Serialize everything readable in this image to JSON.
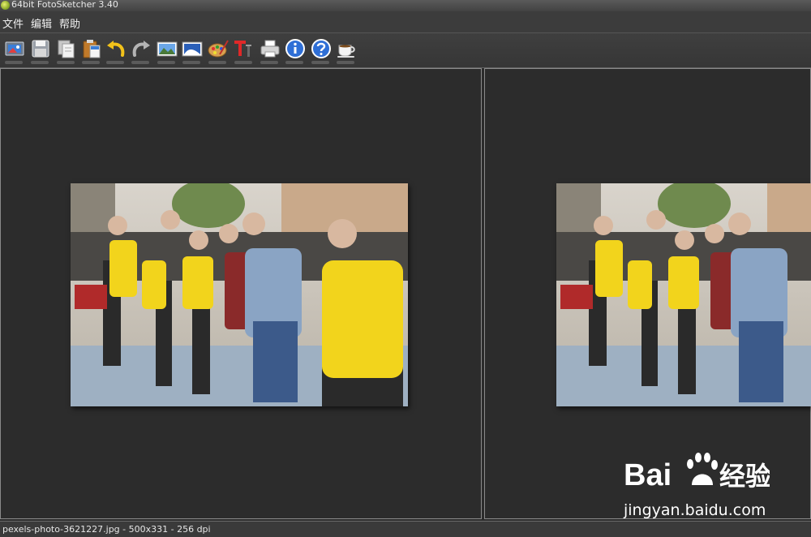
{
  "window": {
    "title": "64bit FotoSketcher 3.40"
  },
  "menu": {
    "items": [
      "文件",
      "编辑",
      "帮助"
    ]
  },
  "toolbar": {
    "buttons": [
      {
        "icon": "open-image-icon"
      },
      {
        "icon": "save-icon"
      },
      {
        "icon": "copy-icon"
      },
      {
        "icon": "paste-icon"
      },
      {
        "icon": "undo-icon"
      },
      {
        "icon": "redo-icon"
      },
      {
        "icon": "original-image-icon"
      },
      {
        "icon": "sketch-image-icon"
      },
      {
        "icon": "palette-icon"
      },
      {
        "icon": "text-icon"
      },
      {
        "icon": "print-icon"
      },
      {
        "icon": "info-icon"
      },
      {
        "icon": "help-icon"
      },
      {
        "icon": "coffee-icon"
      }
    ]
  },
  "status": {
    "text": "pexels-photo-3621227.jpg - 500x331 - 256 dpi"
  },
  "watermark": {
    "logo_text_left": "Bai",
    "logo_text_right": "经验",
    "url": "jingyan.baidu.com"
  },
  "colors": {
    "shirt_yellow": "#f2d41c",
    "background": "#2b2b2b",
    "pane_border": "#8a8a8a"
  }
}
